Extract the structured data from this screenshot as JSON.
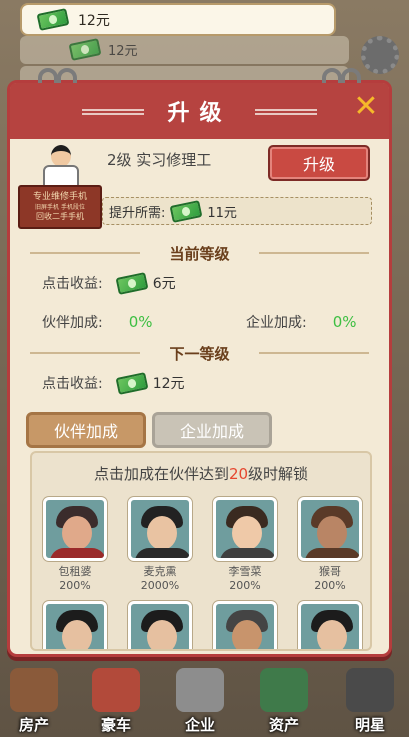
{
  "balance": {
    "amount": "12元"
  },
  "background": {
    "row_amount": "12元"
  },
  "modal": {
    "title": "升级",
    "close_symbol": "✕",
    "stall_lines": [
      "专业维修手机",
      "旧屏手机 手机段位",
      "回收二手手机"
    ],
    "job": {
      "level_name": "2级 实习修理工",
      "upgrade_button": "升级"
    },
    "cost": {
      "label": "提升所需:",
      "amount": "11元"
    },
    "current_level": {
      "heading": "当前等级",
      "click_income_label": "点击收益:",
      "click_income_value": "6元",
      "partner_bonus_label": "伙伴加成:",
      "partner_bonus_value": "0%",
      "company_bonus_label": "企业加成:",
      "company_bonus_value": "0%"
    },
    "next_level": {
      "heading": "下一等级",
      "click_income_label": "点击收益:",
      "click_income_value": "12元"
    },
    "tabs": [
      {
        "label": "伙伴加成",
        "active": true
      },
      {
        "label": "企业加成",
        "active": false
      }
    ],
    "unlock": {
      "prefix": "点击加成在伙伴达到",
      "level": "20",
      "suffix": "级时解锁"
    },
    "partners": [
      {
        "name": "包租婆",
        "bonus": "200%"
      },
      {
        "name": "麦克熏",
        "bonus": "2000%"
      },
      {
        "name": "李雪菜",
        "bonus": "200%"
      },
      {
        "name": "猴哥",
        "bonus": "200%"
      }
    ]
  },
  "bottom_nav": [
    {
      "label": "房产",
      "icon": "house-icon"
    },
    {
      "label": "豪车",
      "icon": "car-icon"
    },
    {
      "label": "企业",
      "icon": "factory-icon"
    },
    {
      "label": "资产",
      "icon": "safe-icon"
    },
    {
      "label": "明星",
      "icon": "star-person-icon"
    }
  ]
}
